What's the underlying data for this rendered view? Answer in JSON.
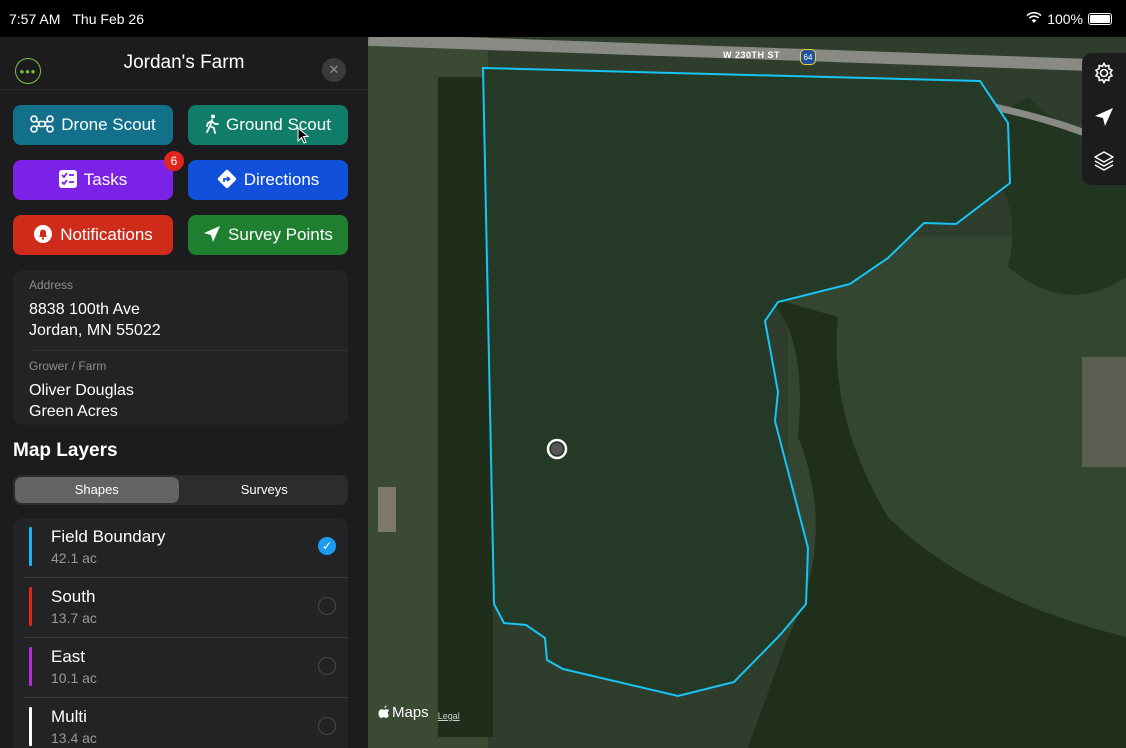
{
  "status_bar": {
    "time": "7:57 AM",
    "date": "Thu Feb 26",
    "battery": "100%"
  },
  "panel": {
    "title": "Jordan's Farm",
    "buttons": [
      {
        "label": "Drone Scout",
        "color": "#13708a",
        "icon": "drone-icon"
      },
      {
        "label": "Ground Scout",
        "color": "#0f7d68",
        "icon": "walking-person-icon"
      },
      {
        "label": "Tasks",
        "color": "#7b22e6",
        "icon": "checklist-icon",
        "badge": "6"
      },
      {
        "label": "Directions",
        "color": "#1150d8",
        "icon": "directions-icon"
      },
      {
        "label": "Notifications",
        "color": "#cf2b1b",
        "icon": "bell-icon"
      },
      {
        "label": "Survey Points",
        "color": "#1d7f2f",
        "icon": "location-arrow-icon"
      }
    ],
    "address": {
      "label": "Address",
      "line1": "8838 100th Ave",
      "line2": "Jordan, MN  55022"
    },
    "grower": {
      "label": "Grower / Farm",
      "line1": "Oliver Douglas",
      "line2": "Green Acres"
    }
  },
  "map_layers": {
    "title": "Map Layers",
    "tabs": [
      "Shapes",
      "Surveys"
    ],
    "active_tab": "Shapes",
    "items": [
      {
        "name": "Field Boundary",
        "area": "42.1 ac",
        "color": "#18b4f0",
        "checked": true
      },
      {
        "name": "South",
        "area": "13.7 ac",
        "color": "#e0261c",
        "checked": false
      },
      {
        "name": "East",
        "area": "10.1 ac",
        "color": "#b32ad6",
        "checked": false
      },
      {
        "name": "Multi",
        "area": "13.4 ac",
        "color": "#ffffff",
        "checked": false
      }
    ]
  },
  "map": {
    "road_label": "W 230TH ST",
    "route_shield": "64",
    "maps_label": "Maps",
    "legal_label": "Legal",
    "boundary_color": "#18c4f5"
  }
}
